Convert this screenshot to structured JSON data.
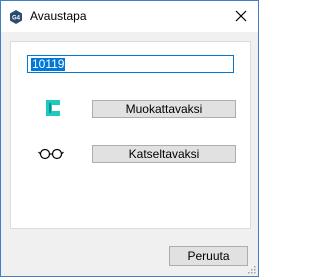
{
  "window": {
    "title": "Avaustapa",
    "app_icon_label": "G4"
  },
  "form": {
    "number_value": "10119"
  },
  "buttons": {
    "edit_label": "Muokattavaksi",
    "view_label": "Katseltavaksi",
    "cancel_label": "Peruuta"
  },
  "icons": {
    "app": "g4-app-icon",
    "close": "close-icon",
    "edit": "edit-mode-icon",
    "view": "glasses-icon",
    "grip": "resize-grip-icon"
  },
  "colors": {
    "accent": "#0078d7",
    "app_icon_bg": "#2b4a6f",
    "edit_icon": "#1fc9c0"
  }
}
